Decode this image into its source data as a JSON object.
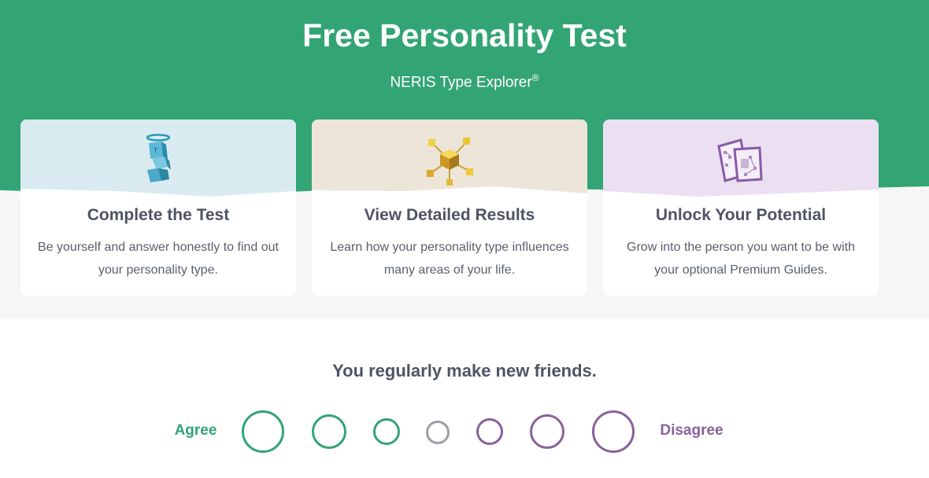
{
  "hero": {
    "title": "Free Personality Test",
    "subtitle": "NERIS Type Explorer",
    "registered_mark": "®",
    "background_color": "#33a474"
  },
  "cards": [
    {
      "title": "Complete the Test",
      "text": "Be yourself and answer honestly to find out your personality type.",
      "icon": "blue-block-figure-icon",
      "top_color": "#d9ebf0"
    },
    {
      "title": "View Detailed Results",
      "text": "Learn how your personality type influences many areas of your life.",
      "icon": "golden-cubes-network-icon",
      "top_color": "#ede5d8"
    },
    {
      "title": "Unlock Your Potential",
      "text": "Grow into the person you want to be with your optional Premium Guides.",
      "icon": "purple-map-documents-icon",
      "top_color": "#ebdff2"
    }
  ],
  "question": {
    "text": "You regularly make new friends.",
    "agree_label": "Agree",
    "disagree_label": "Disagree",
    "agree_color": "#33a474",
    "neutral_color": "#9a9ea8",
    "disagree_color": "#88619a",
    "options": [
      {
        "name": "strongly-agree"
      },
      {
        "name": "agree"
      },
      {
        "name": "slightly-agree"
      },
      {
        "name": "neutral"
      },
      {
        "name": "slightly-disagree"
      },
      {
        "name": "disagree"
      },
      {
        "name": "strongly-disagree"
      }
    ]
  }
}
